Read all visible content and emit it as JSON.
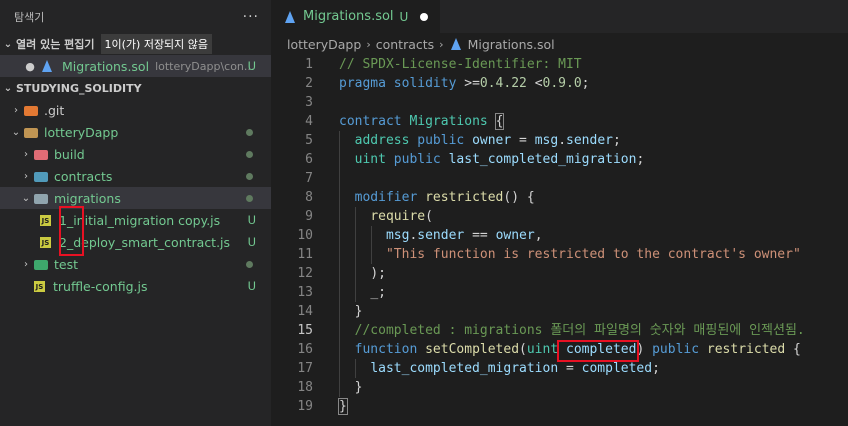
{
  "explorer": {
    "title": "탐색기",
    "more_icon": "ellipsis-icon",
    "open_editors": {
      "label": "열려 있는 편집기",
      "badge": "1이(가) 저장되지 않음",
      "items": [
        {
          "name": "Migrations.sol",
          "path": "lotteryDapp\\con...",
          "status": "U"
        }
      ]
    },
    "workspace": {
      "label": "STUDYING_SOLIDITY",
      "tree": [
        {
          "name": ".git",
          "icon": "git-folder-icon",
          "chevron": "›"
        },
        {
          "name": "lotteryDapp",
          "icon": "folder-icon",
          "chevron": "⌄",
          "dot": true
        },
        {
          "name": "build",
          "icon": "build-folder-icon",
          "chevron": "›",
          "dot": true
        },
        {
          "name": "contracts",
          "icon": "contracts-folder-icon",
          "chevron": "›",
          "dot": true
        },
        {
          "name": "migrations",
          "icon": "migrations-folder-icon",
          "chevron": "⌄",
          "dot": true
        },
        {
          "name": "1_initial_migration copy.js",
          "icon": "js-file-icon",
          "status": "U"
        },
        {
          "name": "2_deploy_smart_contract.js",
          "icon": "js-file-icon",
          "status": "U"
        },
        {
          "name": "test",
          "icon": "test-folder-icon",
          "chevron": "›",
          "dot": true
        },
        {
          "name": "truffle-config.js",
          "icon": "js-file-icon",
          "status": "U"
        }
      ]
    }
  },
  "editor": {
    "tab": {
      "name": "Migrations.sol",
      "status": "U"
    },
    "breadcrumb": [
      "lotteryDapp",
      "contracts",
      "Migrations.sol"
    ],
    "code_lines": [
      "1",
      "2",
      "3",
      "4",
      "5",
      "6",
      "7",
      "8",
      "9",
      "10",
      "11",
      "12",
      "13",
      "14",
      "15",
      "16",
      "17",
      "18",
      "19"
    ]
  },
  "colors": {
    "accent_added": "#73c991",
    "highlight_box": "#e81123"
  }
}
